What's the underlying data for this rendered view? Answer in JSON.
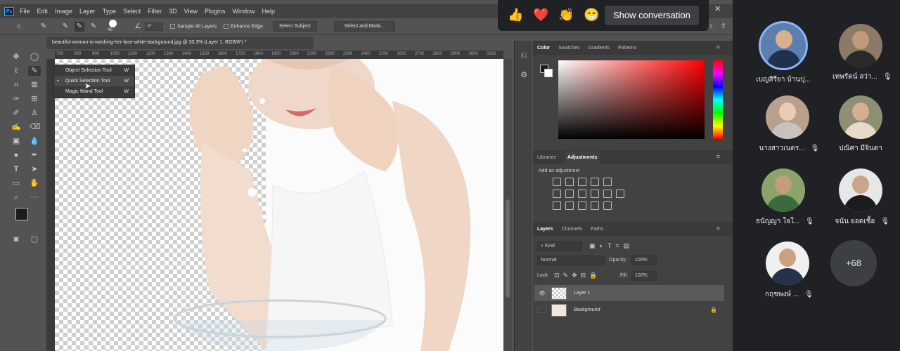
{
  "menu": [
    "File",
    "Edit",
    "Image",
    "Layer",
    "Type",
    "Select",
    "Filter",
    "3D",
    "View",
    "Plugins",
    "Window",
    "Help"
  ],
  "app_logo": "Ps",
  "options": {
    "brush_size": "40",
    "angle": "0°",
    "sample_all_layers": "Sample All Layers",
    "enhance_edge": "Enhance Edge",
    "select_subject": "Select Subject",
    "select_and_mask": "Select and Mask..."
  },
  "document_tab": "beautiful-woman-is-washing-her-face-white-background.jpg @ 33.3% (Layer 1, RGB/8*) *",
  "ruler_ticks": [
    "700",
    "800",
    "900",
    "1000",
    "1100",
    "1200",
    "1300",
    "1400",
    "1500",
    "1600",
    "1700",
    "1800",
    "1900",
    "2000",
    "2100",
    "2200",
    "2300",
    "2400",
    "2500",
    "2600",
    "2700",
    "2800",
    "2900",
    "3000",
    "3100"
  ],
  "tool_flyout": [
    {
      "label": "Object Selection Tool",
      "key": "W"
    },
    {
      "label": "Quick Selection Tool",
      "key": "W"
    },
    {
      "label": "Magic Wand Tool",
      "key": "W"
    }
  ],
  "color_panel": {
    "tabs": [
      "Color",
      "Swatches",
      "Gradients",
      "Patterns"
    ],
    "active": "Color"
  },
  "adjustments_panel": {
    "tabs": [
      "Libraries",
      "Adjustments"
    ],
    "active": "Adjustments",
    "subtitle": "Add an adjustment"
  },
  "layers_panel": {
    "tabs": [
      "Layers",
      "Channels",
      "Paths"
    ],
    "active": "Layers",
    "filter": "Kind",
    "blend_mode": "Normal",
    "opacity_label": "Opacity:",
    "opacity": "100%",
    "lock_label": "Lock:",
    "fill_label": "Fill:",
    "fill": "100%",
    "layers": [
      {
        "name": "Layer 1",
        "selected": true,
        "visible": true
      },
      {
        "name": "Background",
        "selected": false,
        "visible": false,
        "locked": true
      }
    ]
  },
  "reactions": {
    "emojis": [
      "👍",
      "❤️",
      "👏",
      "😁"
    ],
    "show_conversation": "Show conversation"
  },
  "participants": [
    {
      "name": "เบญสิรียา บ้านปุ..."
    },
    {
      "name": "เทพรัตน์ สว่า..."
    },
    {
      "name": "นางสาวเนตร..."
    },
    {
      "name": "ปณิศา มีจินดา"
    },
    {
      "name": "ธนัญญา ใจใ..."
    },
    {
      "name": "จนัน ยอดเชื้อ"
    },
    {
      "name": "กฤชพงษ์ ..."
    }
  ],
  "more_participants": "+68",
  "colors": {
    "ps_bg": "#535353",
    "meet_bg": "#202124",
    "active_speaker_ring": "#8ab4f8",
    "heart": "#ea4335"
  }
}
